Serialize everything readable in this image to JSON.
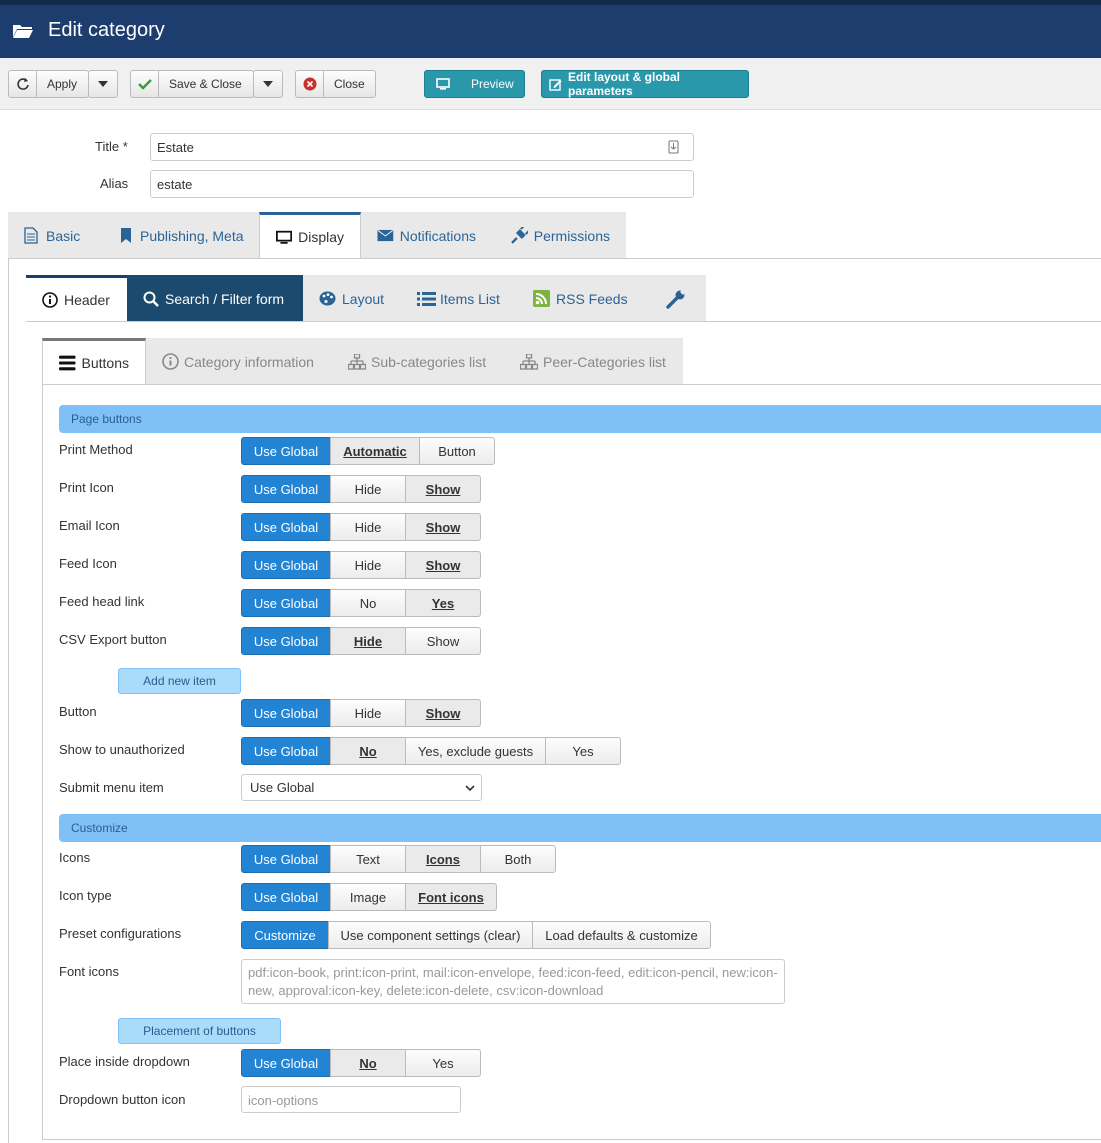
{
  "header": {
    "title": "Edit category"
  },
  "toolbar": {
    "apply": "Apply",
    "save_close": "Save & Close",
    "close": "Close",
    "preview": "Preview",
    "edit_layout": "Edit layout & global parameters"
  },
  "form": {
    "title_label": "Title *",
    "title_value": "Estate",
    "alias_label": "Alias",
    "alias_value": "estate"
  },
  "tabs": [
    "Basic",
    "Publishing, Meta",
    "Display",
    "Notifications",
    "Permissions"
  ],
  "subtabs": [
    "Header",
    "Search / Filter form",
    "Layout",
    "Items List",
    "RSS Feeds"
  ],
  "innertabs": [
    "Buttons",
    "Category information",
    "Sub-categories list",
    "Peer-Categories list"
  ],
  "sections": {
    "page_buttons": "Page buttons",
    "customize": "Customize",
    "add_new_item": "Add new item",
    "placement": "Placement of buttons"
  },
  "rows": {
    "print_method": {
      "label": "Print Method",
      "options": [
        "Use Global",
        "Automatic",
        "Button"
      ]
    },
    "print_icon": {
      "label": "Print Icon",
      "options": [
        "Use Global",
        "Hide",
        "Show"
      ]
    },
    "email_icon": {
      "label": "Email Icon",
      "options": [
        "Use Global",
        "Hide",
        "Show"
      ]
    },
    "feed_icon": {
      "label": "Feed Icon",
      "options": [
        "Use Global",
        "Hide",
        "Show"
      ]
    },
    "feed_head_link": {
      "label": "Feed head link",
      "options": [
        "Use Global",
        "No",
        "Yes"
      ]
    },
    "csv_export": {
      "label": "CSV Export button",
      "options": [
        "Use Global",
        "Hide",
        "Show"
      ]
    },
    "button": {
      "label": "Button",
      "options": [
        "Use Global",
        "Hide",
        "Show"
      ]
    },
    "show_unauth": {
      "label": "Show to unauthorized",
      "options": [
        "Use Global",
        "No",
        "Yes, exclude guests",
        "Yes"
      ]
    },
    "submit_menu": {
      "label": "Submit menu item",
      "value": "Use Global"
    },
    "icons": {
      "label": "Icons",
      "options": [
        "Use Global",
        "Text",
        "Icons",
        "Both"
      ]
    },
    "icon_type": {
      "label": "Icon type",
      "options": [
        "Use Global",
        "Image",
        "Font icons"
      ]
    },
    "preset": {
      "label": "Preset configurations",
      "options": [
        "Customize",
        "Use component settings (clear)",
        "Load defaults & customize"
      ]
    },
    "font_icons": {
      "label": "Font icons",
      "value": "pdf:icon-book, print:icon-print, mail:icon-envelope, feed:icon-feed, edit:icon-pencil, new:icon-new, approval:icon-key, delete:icon-delete, csv:icon-download"
    },
    "place_dropdown": {
      "label": "Place inside dropdown",
      "options": [
        "Use Global",
        "No",
        "Yes"
      ]
    },
    "dropdown_icon": {
      "label": "Dropdown button icon",
      "value": "icon-options"
    }
  },
  "colors": {
    "brand": "#1c3d6e",
    "accent": "#2384d3",
    "teal": "#2a98ab",
    "section": "#7fc1f7"
  }
}
